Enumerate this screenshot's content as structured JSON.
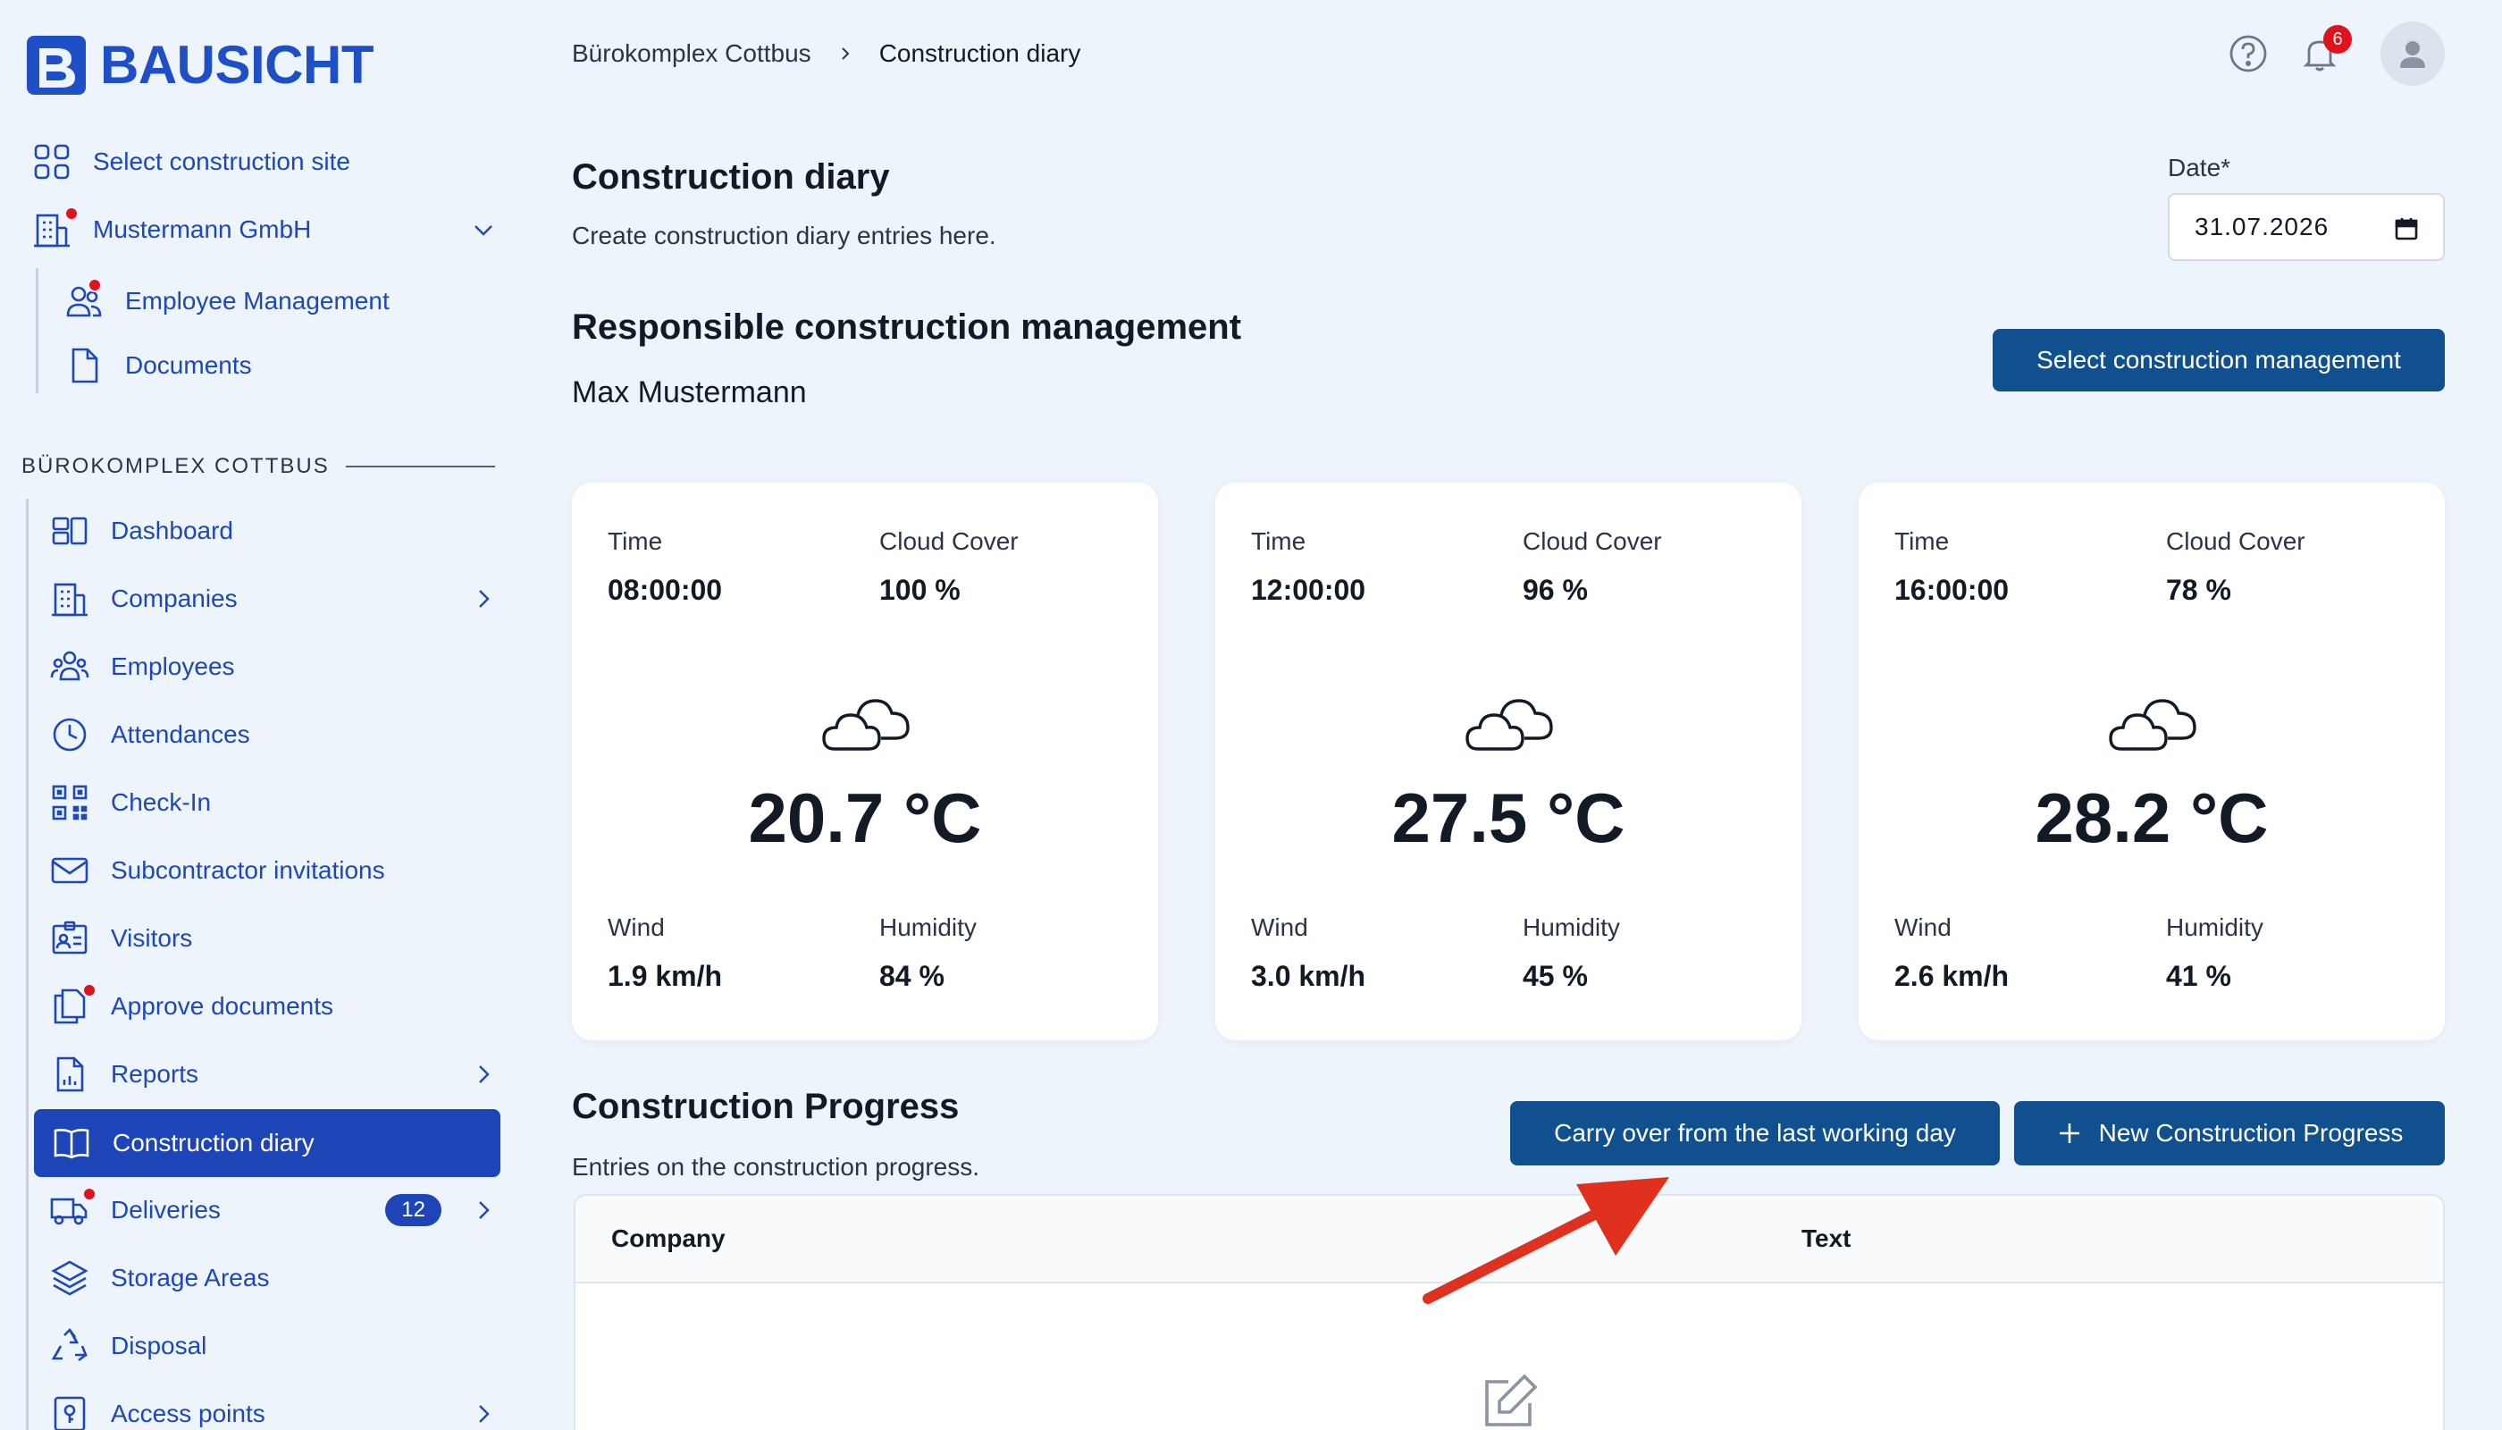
{
  "app": {
    "name": "BAUSICHT"
  },
  "sidebar": {
    "top_items": [
      {
        "label": "Select construction site",
        "icon": "grid-icon"
      },
      {
        "label": "Mustermann GmbH",
        "icon": "building-icon"
      },
      {
        "label": "Employee Management",
        "icon": "users-icon"
      },
      {
        "label": "Documents",
        "icon": "document-icon"
      }
    ],
    "section_title": "BÜROKOMPLEX COTTBUS",
    "items": [
      {
        "label": "Dashboard",
        "icon": "dashboard-icon"
      },
      {
        "label": "Companies",
        "icon": "companies-icon"
      },
      {
        "label": "Employees",
        "icon": "employees-icon"
      },
      {
        "label": "Attendances",
        "icon": "clock-icon"
      },
      {
        "label": "Check-In",
        "icon": "qr-code-icon"
      },
      {
        "label": "Subcontractor invitations",
        "icon": "envelope-icon"
      },
      {
        "label": "Visitors",
        "icon": "id-card-icon"
      },
      {
        "label": "Approve documents",
        "icon": "documents-icon"
      },
      {
        "label": "Reports",
        "icon": "report-icon"
      },
      {
        "label": "Construction diary",
        "icon": "book-icon"
      },
      {
        "label": "Deliveries",
        "icon": "truck-icon",
        "badge": "12"
      },
      {
        "label": "Storage Areas",
        "icon": "layers-icon"
      },
      {
        "label": "Disposal",
        "icon": "recycle-icon"
      },
      {
        "label": "Access points",
        "icon": "access-icon"
      }
    ]
  },
  "header": {
    "breadcrumb": [
      "Bürokomplex Cottbus",
      "Construction diary"
    ],
    "notification_count": "6"
  },
  "page": {
    "title": "Construction diary",
    "subtitle": "Create construction diary entries here.",
    "date_label": "Date*",
    "date_value": "31.07.2026"
  },
  "management": {
    "title": "Responsible construction management",
    "name": "Max Mustermann",
    "button": "Select construction management"
  },
  "weather": {
    "labels": {
      "time": "Time",
      "cloud": "Cloud Cover",
      "wind": "Wind",
      "humidity": "Humidity"
    },
    "cards": [
      {
        "time": "08:00:00",
        "cloud": "100 %",
        "temp": "20.7 °C",
        "wind": "1.9 km/h",
        "humidity": "84 %"
      },
      {
        "time": "12:00:00",
        "cloud": "96 %",
        "temp": "27.5 °C",
        "wind": "3.0 km/h",
        "humidity": "45 %"
      },
      {
        "time": "16:00:00",
        "cloud": "78 %",
        "temp": "28.2 °C",
        "wind": "2.6 km/h",
        "humidity": "41 %"
      }
    ]
  },
  "progress": {
    "title": "Construction Progress",
    "subtitle": "Entries on the construction progress.",
    "carry_over_button": "Carry over from the last working day",
    "new_button": "New Construction Progress",
    "columns": [
      "Company",
      "Text"
    ]
  },
  "colors": {
    "brand": "#1f4fc6",
    "primary_button": "#10508e",
    "active_nav": "#1e45b8",
    "alert": "#e0121e",
    "annotation_arrow": "#e0301e"
  }
}
